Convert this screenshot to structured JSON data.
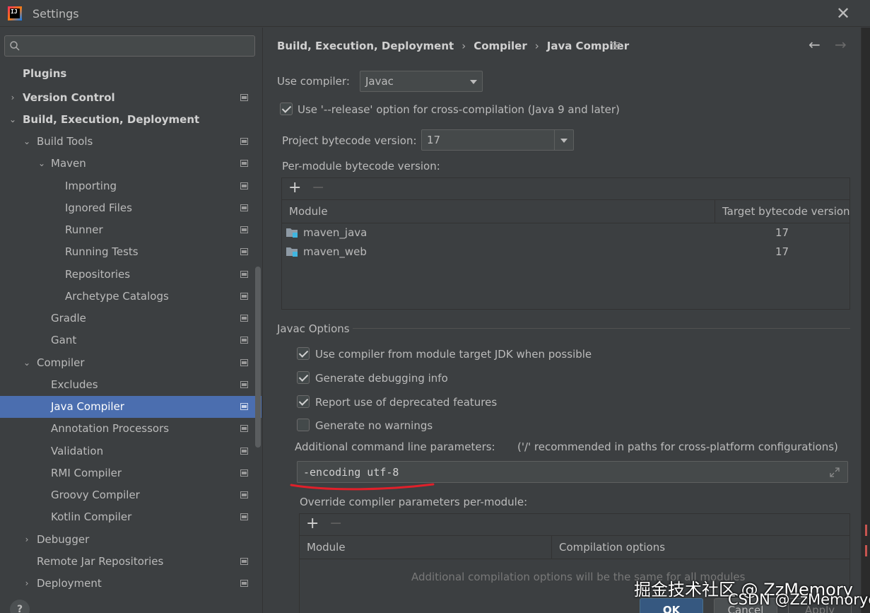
{
  "window": {
    "title": "Settings",
    "logo_text": "IJ"
  },
  "search": {
    "value": "",
    "placeholder": ""
  },
  "sidebar": {
    "items": [
      {
        "label": "Plugins"
      },
      {
        "label": "Version Control"
      },
      {
        "label": "Build, Execution, Deployment"
      },
      {
        "label": "Build Tools"
      },
      {
        "label": "Maven"
      },
      {
        "label": "Importing"
      },
      {
        "label": "Ignored Files"
      },
      {
        "label": "Runner"
      },
      {
        "label": "Running Tests"
      },
      {
        "label": "Repositories"
      },
      {
        "label": "Archetype Catalogs"
      },
      {
        "label": "Gradle"
      },
      {
        "label": "Gant"
      },
      {
        "label": "Compiler"
      },
      {
        "label": "Excludes"
      },
      {
        "label": "Java Compiler"
      },
      {
        "label": "Annotation Processors"
      },
      {
        "label": "Validation"
      },
      {
        "label": "RMI Compiler"
      },
      {
        "label": "Groovy Compiler"
      },
      {
        "label": "Kotlin Compiler"
      },
      {
        "label": "Debugger"
      },
      {
        "label": "Remote Jar Repositories"
      },
      {
        "label": "Deployment"
      }
    ],
    "selected": "Java Compiler",
    "help_label": "?"
  },
  "breadcrumb": {
    "items": [
      "Build, Execution, Deployment",
      "Compiler",
      "Java Compiler"
    ],
    "separator": "›"
  },
  "navigation": {
    "back": "←",
    "forward": "→"
  },
  "compiler": {
    "use_compiler_label": "Use compiler:",
    "use_compiler_value": "Javac",
    "release_option_label": "Use '--release' option for cross-compilation (Java 9 and later)",
    "release_option_checked": true,
    "project_bytecode_label": "Project bytecode version:",
    "project_bytecode_value": "17",
    "per_module_label": "Per-module bytecode version:"
  },
  "bytecode_table": {
    "add": "+",
    "remove": "−",
    "columns": [
      "Module",
      "Target bytecode version"
    ],
    "rows": [
      {
        "module": "maven_java",
        "target": "17"
      },
      {
        "module": "maven_web",
        "target": "17"
      }
    ]
  },
  "javac_options": {
    "title": "Javac Options",
    "checkboxes": [
      {
        "label": "Use compiler from module target JDK when possible",
        "checked": true
      },
      {
        "label": "Generate debugging info",
        "checked": true
      },
      {
        "label": "Report use of deprecated features",
        "checked": true
      },
      {
        "label": "Generate no warnings",
        "checked": false
      }
    ],
    "additional_params_label": "Additional command line parameters:",
    "additional_params_hint": "('/' recommended in paths for cross-platform configurations)",
    "additional_params_value": "-encoding utf-8",
    "override_label": "Override compiler parameters per-module:"
  },
  "override_table": {
    "add": "+",
    "remove": "−",
    "columns": [
      "Module",
      "Compilation options"
    ],
    "empty_text": "Additional compilation options will be the same for all modules"
  },
  "buttons": {
    "ok": "OK",
    "cancel": "Cancel",
    "apply": "Apply"
  },
  "watermark": {
    "line1": "掘金技术社区 @ ZzMemory",
    "line2": "CSDN @ZzMemorye"
  },
  "colors": {
    "background": "#3c3f41",
    "selection": "#4b6eaf",
    "text": "#bbbbbb",
    "ok_button": "#365880",
    "annotation": "#e0202a"
  }
}
